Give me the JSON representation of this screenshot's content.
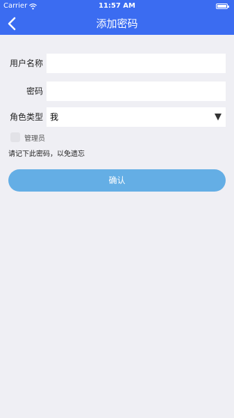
{
  "status_bar": {
    "carrier": "Carrier",
    "time": "11:57 AM",
    "wifi_icon": "wifi-icon",
    "battery_icon": "battery-icon"
  },
  "header": {
    "title": "添加密码",
    "back_icon": "chevron-left-icon",
    "background": "#3b6cf1"
  },
  "form": {
    "username": {
      "label": "用户名称",
      "value": ""
    },
    "password": {
      "label": "密码",
      "value": ""
    },
    "role": {
      "label": "角色类型",
      "selected": "我",
      "icon": "dropdown-triangle-icon"
    },
    "admin_checkbox": {
      "label": "管理员",
      "checked": false
    },
    "hint": "请记下此密码，以免遗忘"
  },
  "actions": {
    "confirm_label": "确认",
    "confirm_color": "#64aee5"
  }
}
